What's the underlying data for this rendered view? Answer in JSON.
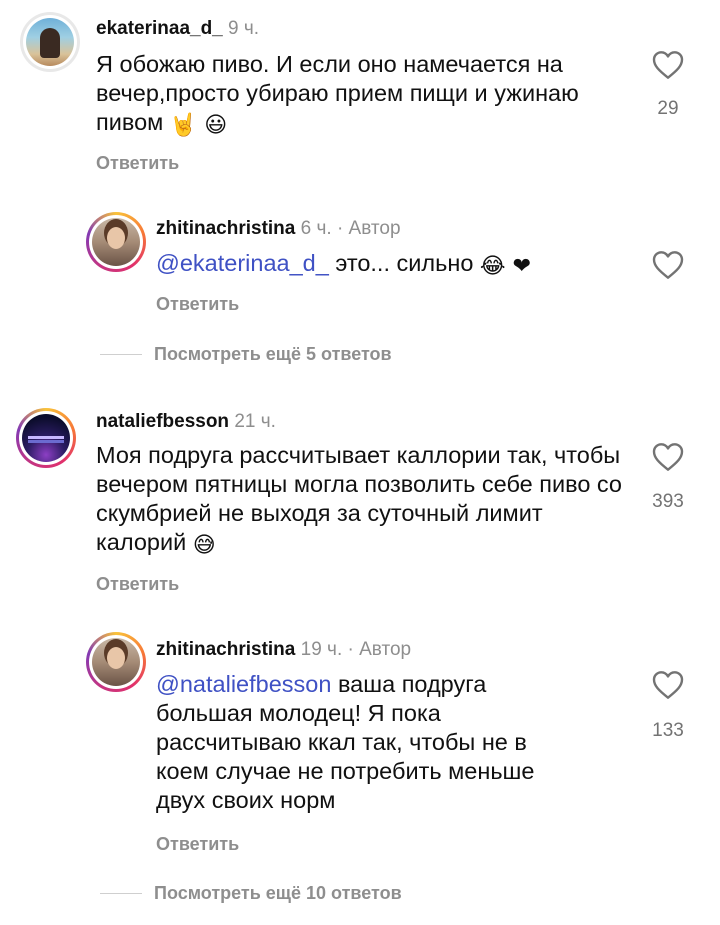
{
  "comments": [
    {
      "username": "ekaterinaa_d_",
      "time": "9 ч.",
      "text": "Я обожаю пиво. И если оно намечается на вечер,просто убираю прием пищи и ужинаю пивом",
      "emojis": "🤘 😃",
      "likes": "29",
      "reply_label": "Ответить"
    },
    {
      "username": "zhitinachristina",
      "time": "6 ч.",
      "author_tag": "· Автор",
      "mention": "@ekaterinaa_d_",
      "text": "это... сильно",
      "emojis": "😂 ❤",
      "likes": "",
      "reply_label": "Ответить"
    },
    {
      "username": "nataliefbesson",
      "time": "21 ч.",
      "text": "Моя подруга рассчитывает каллории так, чтобы вечером пятницы могла позволить себе пиво со скумбрией не выходя за суточный лимит калорий",
      "emojis": "😅",
      "likes": "393",
      "reply_label": "Ответить"
    },
    {
      "username": "zhitinachristina",
      "time": "19 ч.",
      "author_tag": "· Автор",
      "mention": "@nataliefbesson",
      "text": "ваша подруга большая молодец! Я пока рассчитываю ккал так, чтобы не в коем случае не потребить меньше двух своих норм",
      "likes": "133",
      "reply_label": "Ответить"
    }
  ],
  "view_more": [
    "Посмотреть ещё 5 ответов",
    "Посмотреть ещё 10 ответов"
  ],
  "icons": {
    "like": "heart-outline-icon"
  },
  "colors": {
    "mention": "#3f51c4",
    "secondary_text": "#8e8e8e"
  }
}
